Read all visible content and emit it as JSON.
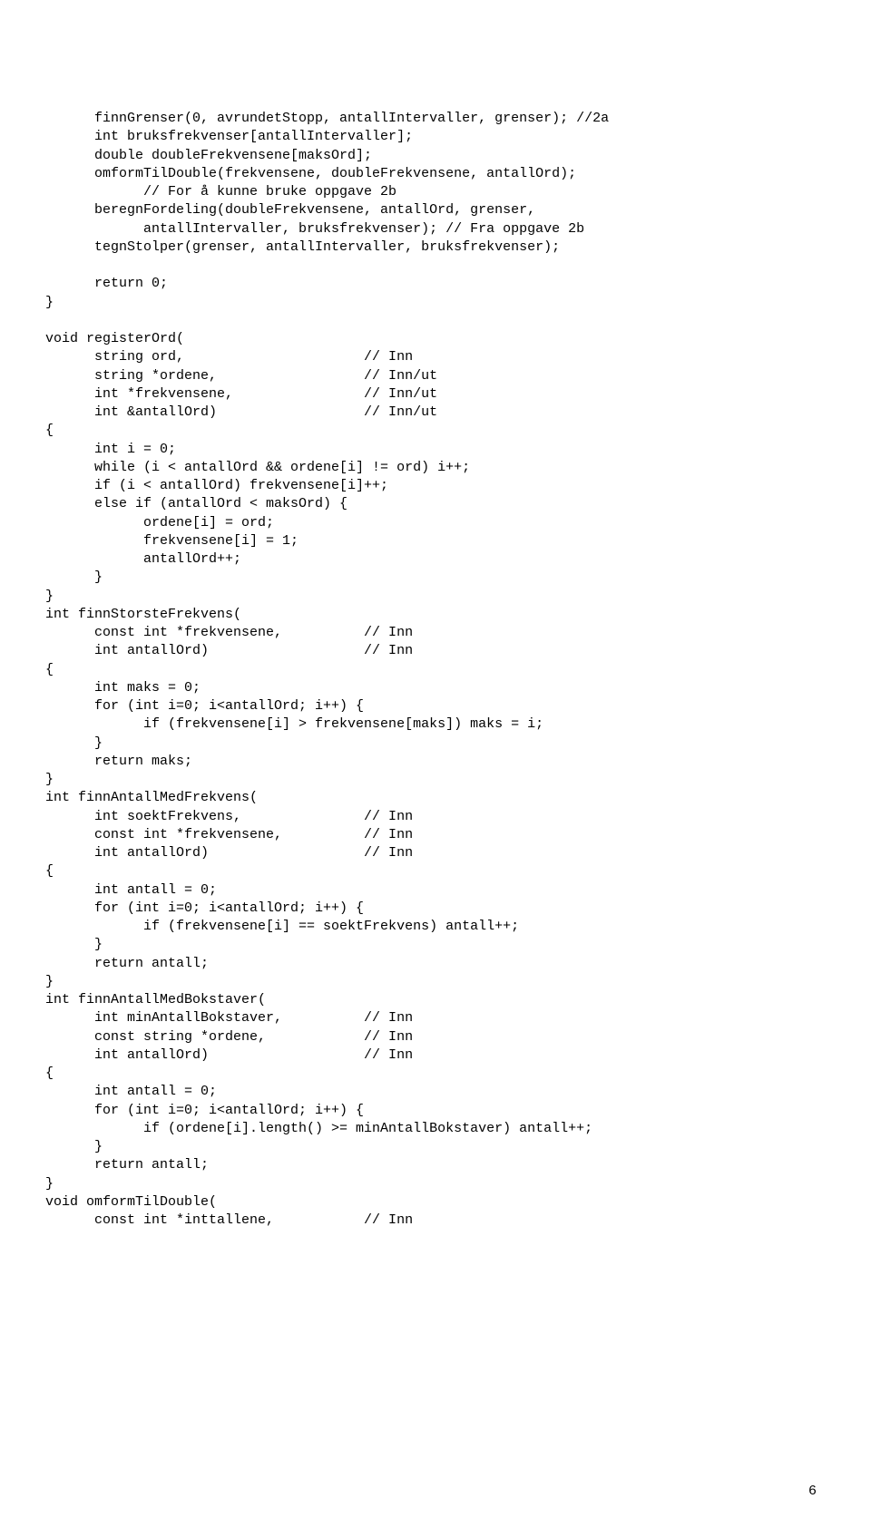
{
  "pageNumber": "6",
  "lines": [
    "      finnGrenser(0, avrundetStopp, antallIntervaller, grenser); //2a",
    "      int bruksfrekvenser[antallIntervaller];",
    "      double doubleFrekvensene[maksOrd];",
    "      omformTilDouble(frekvensene, doubleFrekvensene, antallOrd);",
    "            // For å kunne bruke oppgave 2b",
    "      beregnFordeling(doubleFrekvensene, antallOrd, grenser,",
    "            antallIntervaller, bruksfrekvenser); // Fra oppgave 2b",
    "      tegnStolper(grenser, antallIntervaller, bruksfrekvenser);",
    "",
    "      return 0;",
    "}",
    "",
    "void registerOrd(",
    "      string ord,                      // Inn",
    "      string *ordene,                  // Inn/ut",
    "      int *frekvensene,                // Inn/ut",
    "      int &antallOrd)                  // Inn/ut",
    "{",
    "      int i = 0;",
    "      while (i < antallOrd && ordene[i] != ord) i++;",
    "      if (i < antallOrd) frekvensene[i]++;",
    "      else if (antallOrd < maksOrd) {",
    "            ordene[i] = ord;",
    "            frekvensene[i] = 1;",
    "            antallOrd++;",
    "      }",
    "}",
    "int finnStorsteFrekvens(",
    "      const int *frekvensene,          // Inn",
    "      int antallOrd)                   // Inn",
    "{",
    "      int maks = 0;",
    "      for (int i=0; i<antallOrd; i++) {",
    "            if (frekvensene[i] > frekvensene[maks]) maks = i;",
    "      }",
    "      return maks;",
    "}",
    "int finnAntallMedFrekvens(",
    "      int soektFrekvens,               // Inn",
    "      const int *frekvensene,          // Inn",
    "      int antallOrd)                   // Inn",
    "{",
    "      int antall = 0;",
    "      for (int i=0; i<antallOrd; i++) {",
    "            if (frekvensene[i] == soektFrekvens) antall++;",
    "      }",
    "      return antall;",
    "}",
    "int finnAntallMedBokstaver(",
    "      int minAntallBokstaver,          // Inn",
    "      const string *ordene,            // Inn",
    "      int antallOrd)                   // Inn",
    "{",
    "      int antall = 0;",
    "      for (int i=0; i<antallOrd; i++) {",
    "            if (ordene[i].length() >= minAntallBokstaver) antall++;",
    "      }",
    "      return antall;",
    "}",
    "void omformTilDouble(",
    "      const int *inttallene,           // Inn"
  ]
}
